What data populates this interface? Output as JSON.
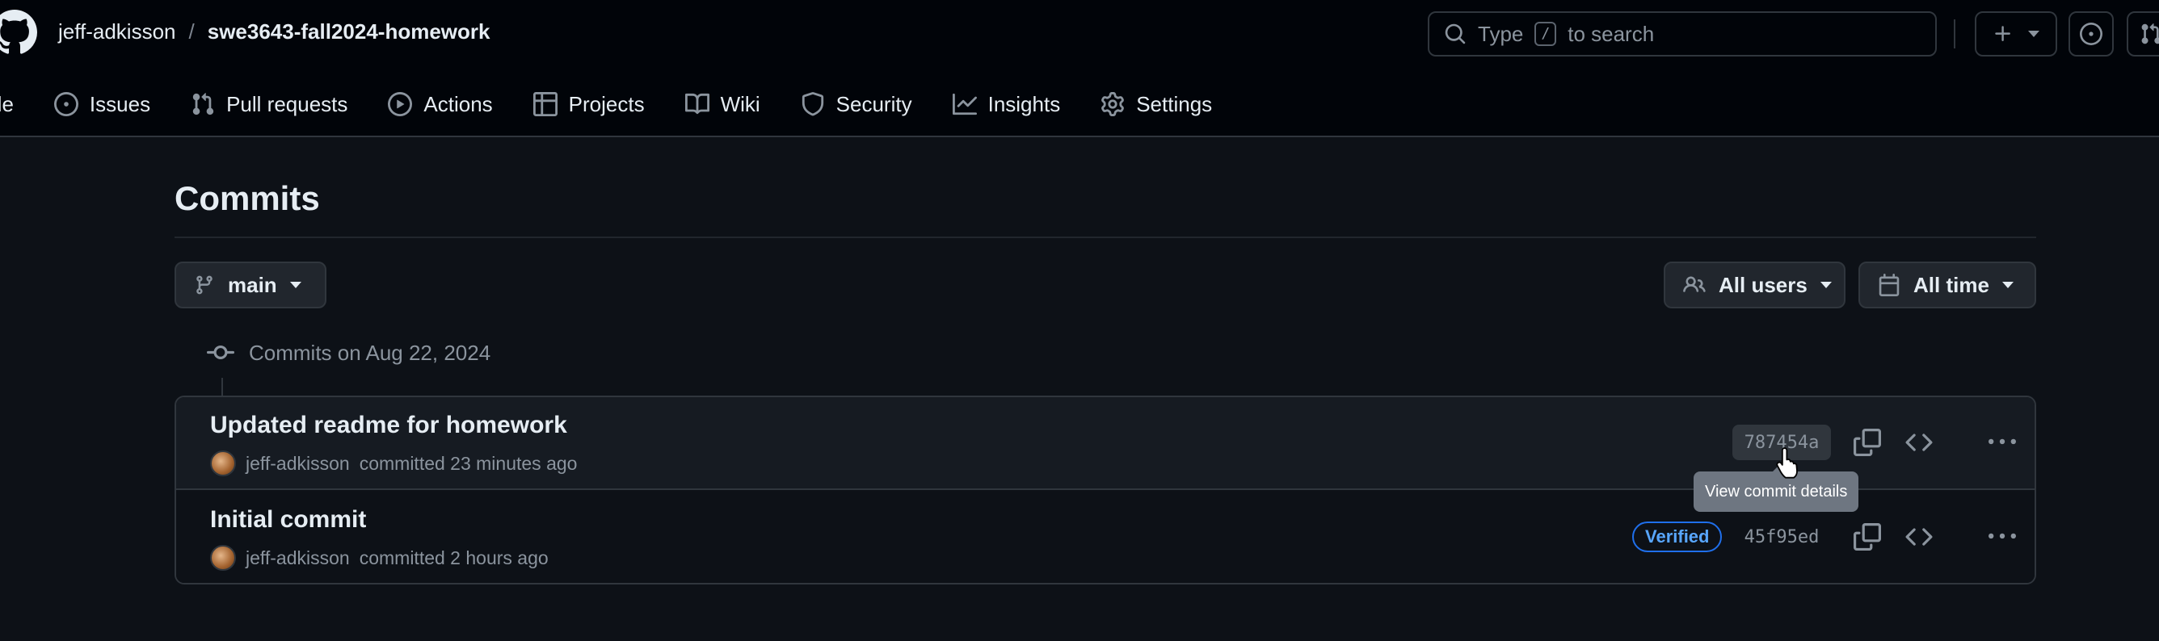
{
  "header": {
    "owner": "jeff-adkisson",
    "separator": "/",
    "repo": "swe3643-fall2024-homework",
    "search_prefix": "Type",
    "search_key": "/",
    "search_suffix": "to search"
  },
  "nav": {
    "items": [
      {
        "label": "de",
        "icon": "code-icon"
      },
      {
        "label": "Issues",
        "icon": "issue-icon"
      },
      {
        "label": "Pull requests",
        "icon": "pull-request-icon"
      },
      {
        "label": "Actions",
        "icon": "play-icon"
      },
      {
        "label": "Projects",
        "icon": "table-icon"
      },
      {
        "label": "Wiki",
        "icon": "book-icon"
      },
      {
        "label": "Security",
        "icon": "shield-icon"
      },
      {
        "label": "Insights",
        "icon": "graph-icon"
      },
      {
        "label": "Settings",
        "icon": "gear-icon"
      }
    ]
  },
  "page": {
    "title": "Commits"
  },
  "filters": {
    "branch": "main",
    "users": "All users",
    "time": "All time"
  },
  "group": {
    "heading": "Commits on Aug 22, 2024"
  },
  "commits": [
    {
      "message": "Updated readme for homework",
      "author": "jeff-adkisson",
      "action": "committed 23 minutes ago",
      "sha": "787454a",
      "verified": ""
    },
    {
      "message": "Initial commit",
      "author": "jeff-adkisson",
      "action": "committed 2 hours ago",
      "sha": "45f95ed",
      "verified": "Verified"
    }
  ],
  "tooltip": {
    "text": "View commit details"
  },
  "colors": {
    "background": "#0d1117",
    "header": "#010409",
    "border": "#30363d",
    "accent_blue": "#58a6ff"
  }
}
